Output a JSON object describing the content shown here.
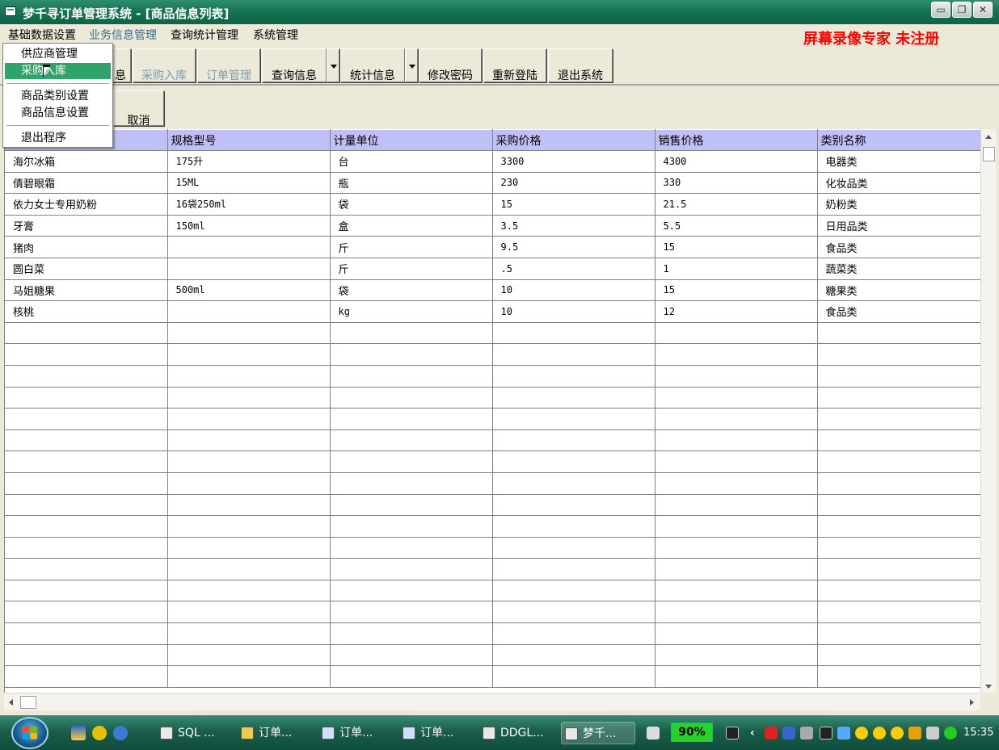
{
  "window": {
    "title": "梦千寻订单管理系统 - [商品信息列表]",
    "controls": [
      "restore",
      "maximize",
      "close"
    ]
  },
  "menubar": {
    "items": [
      "基础数据设置",
      "业务信息管理",
      "查询统计管理",
      "系统管理"
    ],
    "watermark": "屏幕录像专家  未注册"
  },
  "dropdown": {
    "items": [
      "供应商管理",
      "采购入库",
      "商品类别设置",
      "商品信息设置",
      "退出程序"
    ],
    "highlighted": "采购入库"
  },
  "toolbar": {
    "partial_button": "息",
    "buttons": [
      "采购入库",
      "订单管理",
      "查询信息",
      "统计信息",
      "修改密码",
      "重新登陆",
      "退出系统"
    ]
  },
  "toolbar2": {
    "cancel": "取消"
  },
  "table": {
    "columns": [
      "",
      "规格型号",
      "计量单位",
      "采购价格",
      "销售价格",
      "类别名称"
    ],
    "rows": [
      [
        "海尔冰箱",
        "175升",
        "台",
        "3300",
        "4300",
        "电器类"
      ],
      [
        "倩碧眼霜",
        "15ML",
        "瓶",
        "230",
        "330",
        "化妆品类"
      ],
      [
        "依力女士专用奶粉",
        "16袋250ml",
        "袋",
        "15",
        "21.5",
        "奶粉类"
      ],
      [
        "牙膏",
        "150ml",
        "盒",
        "3.5",
        "5.5",
        "日用品类"
      ],
      [
        "猪肉",
        "",
        "斤",
        "9.5",
        "15",
        "食品类"
      ],
      [
        "圆白菜",
        "",
        "斤",
        ".5",
        "1",
        "蔬菜类"
      ],
      [
        "马姐糖果",
        "500ml",
        "袋",
        "10",
        "15",
        "糖果类"
      ],
      [
        "核桃",
        "",
        "kg",
        "10",
        "12",
        "食品类"
      ]
    ],
    "empty_rows": 17
  },
  "taskbar": {
    "tasks": [
      "SQL ...",
      "订单...",
      "订单...",
      "订单...",
      "DDGL...",
      "梦千..."
    ],
    "battery": "90%",
    "clock": "15:35"
  },
  "colors": {
    "titlebar": "#1a7654",
    "header_bg": "#c0c0f8",
    "highlight": "#2ea36a",
    "watermark": "#ff0000"
  }
}
